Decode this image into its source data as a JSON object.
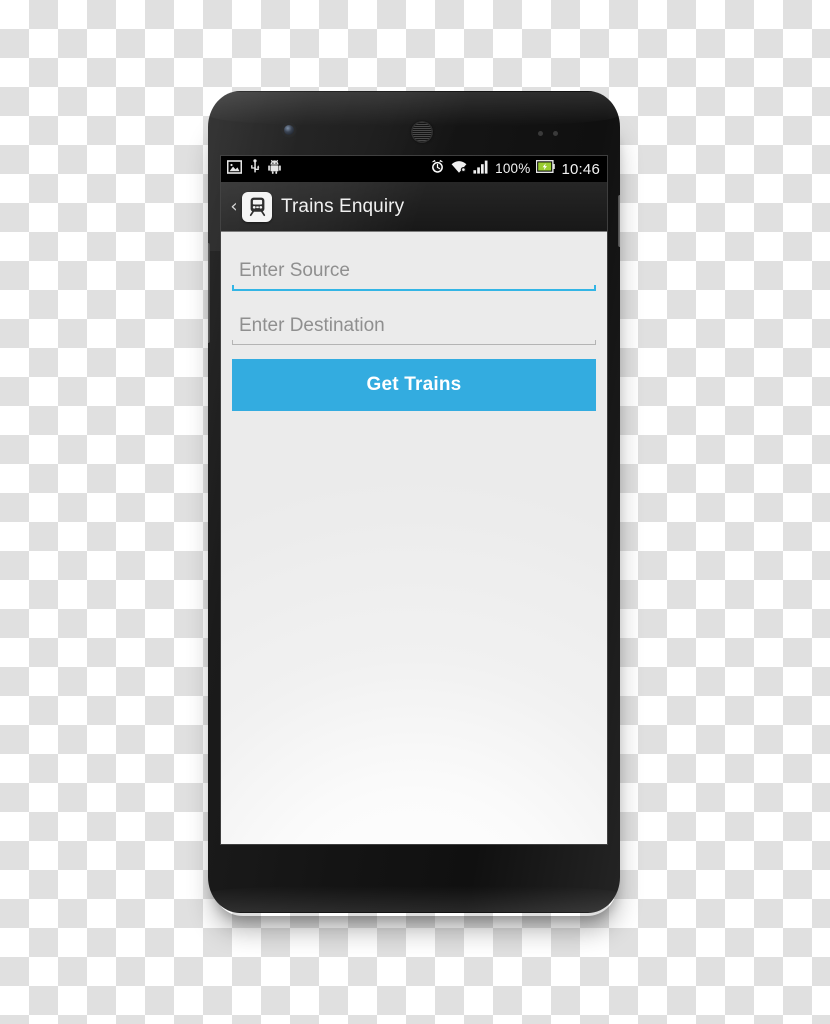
{
  "device": {
    "type": "android-smartphone",
    "hardware": {
      "front_camera": "front-camera",
      "earpiece": "earpiece-speaker",
      "power_button": "power-button",
      "volume_button": "volume-rocker",
      "sensors": "proximity-light-sensor"
    }
  },
  "status_bar": {
    "left_icons": [
      {
        "name": "screenshot-icon",
        "label": "Screenshot"
      },
      {
        "name": "usb-icon",
        "label": "USB connected"
      },
      {
        "name": "android-debug-icon",
        "label": "USB debugging"
      }
    ],
    "right_icons": [
      {
        "name": "alarm-icon",
        "label": "Alarm set"
      },
      {
        "name": "wifi-icon",
        "label": "Wi-Fi"
      },
      {
        "name": "signal-icon",
        "label": "Mobile signal"
      },
      {
        "name": "battery-icon",
        "label": "Battery charging"
      }
    ],
    "battery_percent": "100%",
    "clock": "10:46",
    "background_color": "#000000",
    "text_color": "#f2f2f2"
  },
  "action_bar": {
    "back_chevron": "‹",
    "app_icon": "train-icon",
    "title": "Trains Enquiry",
    "background_color": "#1e1e1e",
    "text_color": "#f0f0f0"
  },
  "form": {
    "fields": [
      {
        "name": "source-input",
        "placeholder": "Enter Source",
        "value": "",
        "focused": true,
        "underline_color": "#33b5e5"
      },
      {
        "name": "destination-input",
        "placeholder": "Enter Destination",
        "value": "",
        "focused": false,
        "underline_color": "#b4b4b4"
      }
    ],
    "submit_button": {
      "label": "Get Trains",
      "background_color": "#33ace0",
      "text_color": "#ffffff"
    }
  },
  "theme": {
    "accent": "#33b5e5",
    "button": "#33ace0",
    "content_background": "#ededed",
    "placeholder_text": "#8f8f8f"
  }
}
